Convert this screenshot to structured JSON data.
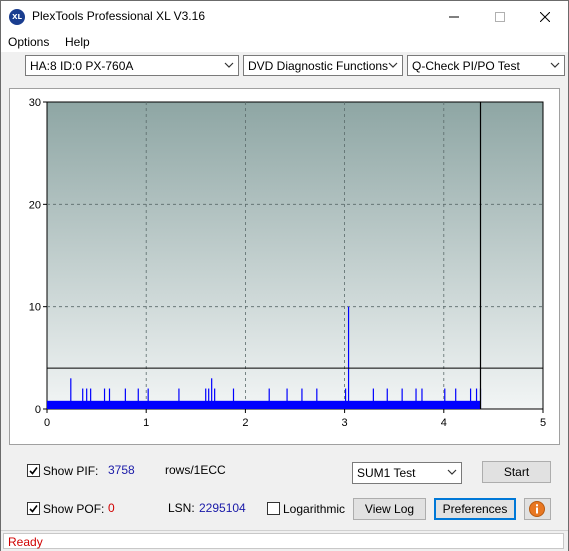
{
  "window": {
    "title": "PlexTools Professional XL V3.16",
    "app_icon_text": "XL"
  },
  "menu": {
    "options": "Options",
    "help": "Help"
  },
  "toolbar": {
    "drive": "HA:8 ID:0  PX-760A",
    "function": "DVD Diagnostic Functions",
    "test": "Q-Check PI/PO Test"
  },
  "chart_data": {
    "type": "bar",
    "x_ticks": [
      "0",
      "1",
      "2",
      "3",
      "4",
      "5"
    ],
    "y_ticks": [
      "0",
      "10",
      "20",
      "30"
    ],
    "xlim": [
      0,
      5
    ],
    "ylim": [
      0,
      30
    ],
    "grid": true,
    "threshold": 4,
    "data_end_x": 4.37,
    "baseline": 0.8,
    "spikes": [
      {
        "x": 0.24,
        "y": 3
      },
      {
        "x": 0.36,
        "y": 2
      },
      {
        "x": 0.4,
        "y": 2
      },
      {
        "x": 0.44,
        "y": 2
      },
      {
        "x": 0.58,
        "y": 2
      },
      {
        "x": 0.63,
        "y": 2
      },
      {
        "x": 0.79,
        "y": 2
      },
      {
        "x": 0.92,
        "y": 2
      },
      {
        "x": 1.02,
        "y": 2
      },
      {
        "x": 1.33,
        "y": 2
      },
      {
        "x": 1.6,
        "y": 2
      },
      {
        "x": 1.63,
        "y": 2
      },
      {
        "x": 1.66,
        "y": 3
      },
      {
        "x": 1.69,
        "y": 2
      },
      {
        "x": 1.88,
        "y": 2
      },
      {
        "x": 2.24,
        "y": 2
      },
      {
        "x": 2.42,
        "y": 2
      },
      {
        "x": 2.57,
        "y": 2
      },
      {
        "x": 2.72,
        "y": 2
      },
      {
        "x": 3.01,
        "y": 2
      },
      {
        "x": 3.04,
        "y": 10
      },
      {
        "x": 3.29,
        "y": 2
      },
      {
        "x": 3.43,
        "y": 2
      },
      {
        "x": 3.58,
        "y": 2
      },
      {
        "x": 3.72,
        "y": 2
      },
      {
        "x": 3.78,
        "y": 2
      },
      {
        "x": 4.01,
        "y": 2
      },
      {
        "x": 4.12,
        "y": 2
      },
      {
        "x": 4.27,
        "y": 2
      },
      {
        "x": 4.33,
        "y": 2
      },
      {
        "x": 4.37,
        "y": 2
      }
    ],
    "colors": {
      "plot_top": "#8ea6a4",
      "plot_bottom": "#f2f5f5",
      "bars": "#0000ff",
      "grid": "#5a6a6a"
    }
  },
  "controls": {
    "show_pif_label": "Show PIF:",
    "pif_value": "3758",
    "pif_unit": "rows/1ECC",
    "show_pof_label": "Show POF:",
    "pof_value": "0",
    "lsn_label": "LSN:",
    "lsn_value": "2295104",
    "logarithmic_label": "Logarithmic",
    "sum_select": "SUM1 Test",
    "start_button": "Start",
    "view_log_button": "View Log",
    "preferences_button": "Preferences",
    "info_icon": "info-icon"
  },
  "status": {
    "text": "Ready"
  }
}
